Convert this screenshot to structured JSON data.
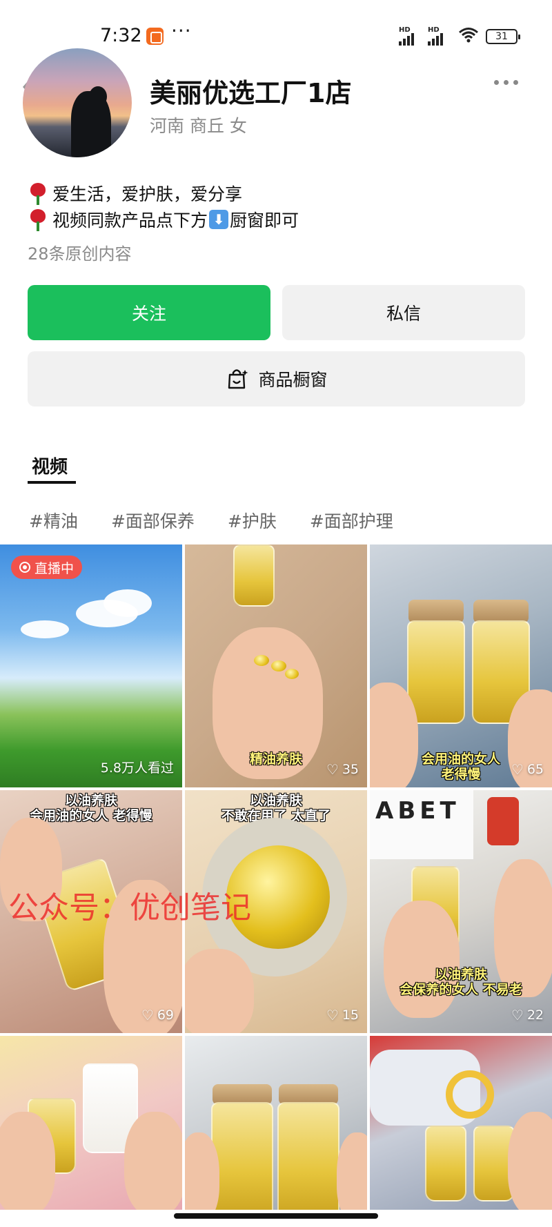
{
  "status_bar": {
    "time": "7:32",
    "more": "···",
    "hd_labels": [
      "HD",
      "HD"
    ],
    "wifi_sub": "6",
    "battery": "31"
  },
  "profile": {
    "name": "美丽优选工厂1店",
    "location": "河南 商丘 女",
    "bio_lines": [
      "爱生活，爱护肤，爱分享",
      "视频同款产品点下方",
      "厨窗即可"
    ],
    "arrow_glyph": "⬇",
    "original_count": "28条原创内容"
  },
  "actions": {
    "follow": "关注",
    "message": "私信",
    "shop": "商品橱窗"
  },
  "tabs": {
    "video": "视频"
  },
  "tags": [
    "#精油",
    "#面部保养",
    "#护肤",
    "#面部护理"
  ],
  "videos": [
    {
      "live_label": "直播中",
      "views": "5.8万人看过"
    },
    {
      "caption": "精油养肤",
      "likes": "35"
    },
    {
      "caption": "会用油的女人\n老得慢",
      "likes": "65"
    },
    {
      "caption": "以油养肤\n会用油的女人 老得慢",
      "likes": "69"
    },
    {
      "caption": "以油养肤\n不敢在用了 太直了",
      "likes": "15"
    },
    {
      "caption": "以油养肤\n会保养的女人 不易老",
      "likes": "22",
      "brand_text": "ABET"
    },
    {},
    {},
    {}
  ],
  "watermark": "公众号：优创笔记",
  "colors": {
    "follow_green": "#1bbf5c",
    "live_red": "#f0524b",
    "watermark_red": "#ec2828"
  }
}
